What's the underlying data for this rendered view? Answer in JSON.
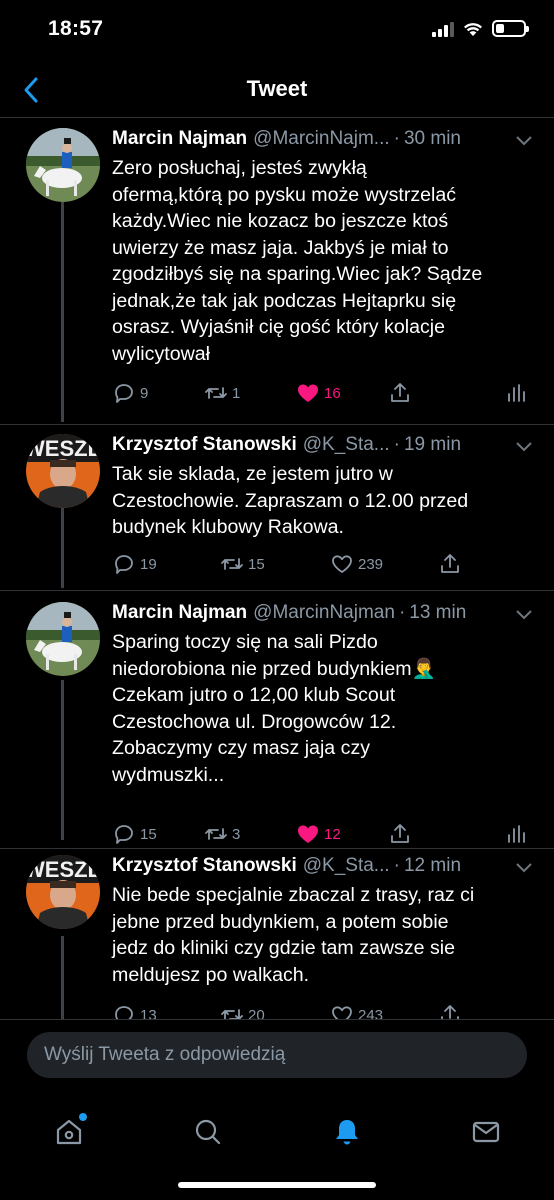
{
  "status_bar": {
    "time": "18:57"
  },
  "header": {
    "title": "Tweet"
  },
  "tweets": [
    {
      "name": "Marcin Najman",
      "handle": "@MarcinNajm...",
      "time": "30 min",
      "text": "Zero posłuchaj, jesteś zwykłą\nofermą,którą po pysku może wystrzelać\nkażdy.Wiec nie kozacz bo jeszcze ktoś\nuwierzy że masz jaja. Jakbyś je miał to\nzgodziłbyś się na sparing.Wiec jak? Sądze\njednak,że tak jak podczas Hejtaprku się\nosrasz. Wyjaśnił cię gość który kolacje\nwylicytował",
      "replies": "9",
      "retweets": "1",
      "likes": "16",
      "liked": true
    },
    {
      "name": "Krzysztof Stanowski",
      "handle": "@K_Sta...",
      "time": "19 min",
      "text": "Tak sie sklada, ze jestem jutro w\nCzestochowie. Zapraszam o 12.00 przed\nbudynek klubowy Rakowa.",
      "replies": "19",
      "retweets": "15",
      "likes": "239",
      "liked": false
    },
    {
      "name": "Marcin Najman",
      "handle": "@MarcinNajman",
      "time": "13 min",
      "text": "Sparing toczy się na sali Pizdo\nniedorobiona nie przed budynkiem🤦‍♂️\nCzekam jutro o 12,00 klub Scout\nCzestochowa ul. Drogowców 12.\nZobaczymy czy masz jaja czy\nwydmuszki...",
      "replies": "15",
      "retweets": "3",
      "likes": "12",
      "liked": true
    },
    {
      "name": "Krzysztof Stanowski",
      "handle": "@K_Sta...",
      "time": "12 min",
      "text": "Nie bede specjalnie zbaczal z trasy, raz ci\njebne przed budynkiem, a potem sobie\njedz do kliniki czy gdzie tam zawsze sie\nmeldujesz po walkach.",
      "replies": "13",
      "retweets": "20",
      "likes": "243",
      "liked": false
    }
  ],
  "reply_bar": {
    "placeholder": "Wyślij Tweeta z odpowiedzią"
  },
  "tab_bar": {
    "items": [
      "home-icon",
      "search-icon",
      "notifications-icon",
      "messages-icon"
    ],
    "active": "notifications-icon"
  },
  "colors": {
    "background": "#000000",
    "accent": "#1d9bf0",
    "like": "#f91880",
    "secondary_text": "#8b98a5",
    "divider": "#2f3336"
  }
}
